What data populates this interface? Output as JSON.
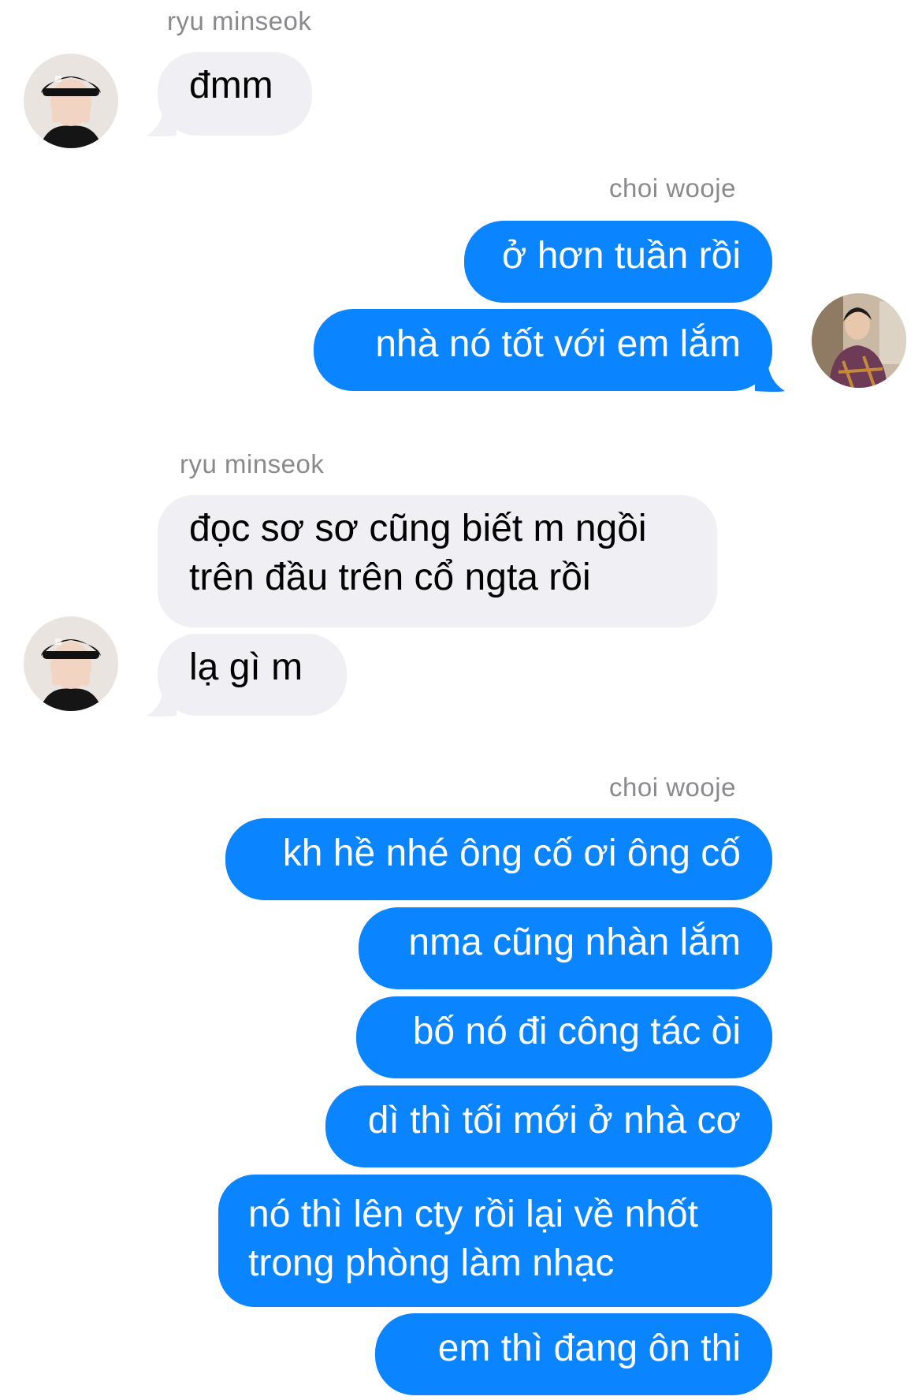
{
  "thread": {
    "groups": [
      {
        "sender": "ryu minseok",
        "side": "incoming",
        "messages": [
          "đmm"
        ]
      },
      {
        "sender": "choi wooje",
        "side": "outgoing",
        "messages": [
          "ở hơn tuần rồi",
          "nhà nó tốt với em lắm"
        ]
      },
      {
        "sender": "ryu minseok",
        "side": "incoming",
        "messages": [
          [
            "đọc sơ sơ cũng biết m ngồi",
            "trên đầu trên cổ ngta rồi"
          ],
          "lạ gì m"
        ]
      },
      {
        "sender": "choi wooje",
        "side": "outgoing",
        "messages": [
          "kh hề nhé ông cố ơi ông cố",
          "nma cũng nhàn lắm",
          "bố nó đi công tác òi",
          "dì thì tối mới ở nhà cơ",
          [
            "nó thì lên cty rồi lại về nhốt",
            "trong phòng làm nhạc"
          ],
          "em thì đang ôn thi"
        ]
      }
    ]
  },
  "colors": {
    "outgoing_bubble": "#0a84ff",
    "incoming_bubble": "#efeff4",
    "sender_name": "#8a8a8e",
    "background": "#ffffff"
  },
  "icons": {
    "incoming_avatar": "avatar-ryu-minseok",
    "outgoing_avatar": "avatar-choi-wooje"
  }
}
